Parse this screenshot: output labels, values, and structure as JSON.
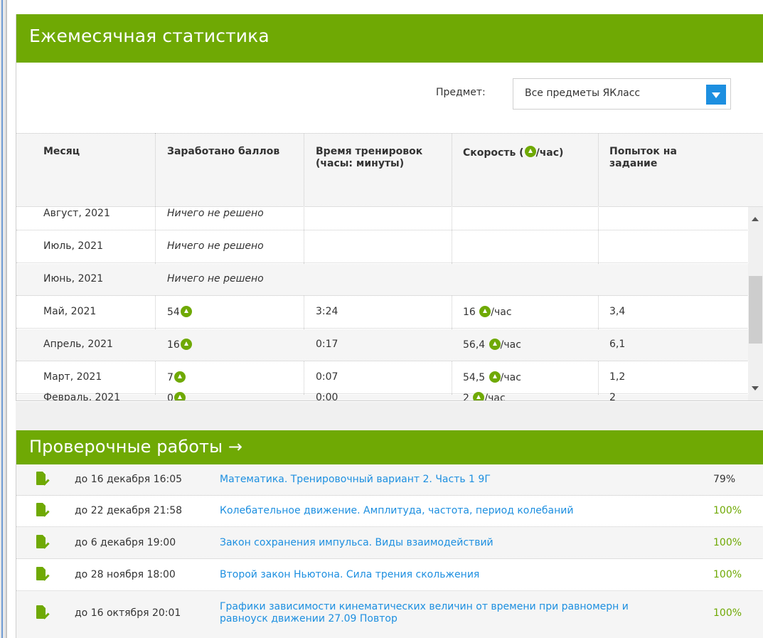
{
  "stats": {
    "title": "Ежемесячная статистика",
    "filter": {
      "label": "Предмет:",
      "value": "Все предметы ЯКласс"
    },
    "columns": [
      "Месяц",
      "Заработано баллов",
      "Время тренировок (часы: минуты)",
      "Скорость (",
      "/час)",
      "Попыток на задание"
    ],
    "rows": [
      {
        "month": "Август, 2021",
        "points": "Ничего не решено",
        "time": "",
        "speed": "",
        "attempts": ""
      },
      {
        "month": "Июль, 2021",
        "points": "Ничего не решено",
        "time": "",
        "speed": "",
        "attempts": ""
      },
      {
        "month": "Июнь, 2021",
        "points": "Ничего не решено",
        "time": "",
        "speed": "",
        "attempts": ""
      },
      {
        "month": "Май, 2021",
        "points": "54",
        "time": "3:24",
        "speed": "16",
        "attempts": "3,4"
      },
      {
        "month": "Апрель, 2021",
        "points": "16",
        "time": "0:17",
        "speed": "56,4",
        "attempts": "6,1"
      },
      {
        "month": "Март, 2021",
        "points": "7",
        "time": "0:07",
        "speed": "54,5",
        "attempts": "1,2"
      },
      {
        "month": "Февраль, 2021",
        "points": "0",
        "time": "0:00",
        "speed": "2",
        "attempts": "2"
      }
    ],
    "speed_unit": "/час"
  },
  "tests": {
    "title": "Проверочные работы →",
    "items": [
      {
        "deadline": "до 16 декабря 16:05",
        "name": "Математика. Тренировочный вариант 2. Часть 1 9Г",
        "score": "79%"
      },
      {
        "deadline": "до 22 декабря 21:58",
        "name": "Колебательное движение. Амплитуда, частота, период колебаний",
        "score": "100%"
      },
      {
        "deadline": "до 6 декабря 19:00",
        "name": "Закон сохранения импульса. Виды взаимодействий",
        "score": "100%"
      },
      {
        "deadline": "до 28 ноября 18:00",
        "name": "Второй закон Ньютона. Сила трения скольжения",
        "score": "100%"
      },
      {
        "deadline": "до 16 октября 20:01",
        "name": "Графики зависимости кинематических величин от времени при равномерн и равноуск движении 27.09 Повтор",
        "score": "100%"
      }
    ]
  },
  "colors": {
    "accent": "#6fa904",
    "link": "#1d8fe0"
  }
}
